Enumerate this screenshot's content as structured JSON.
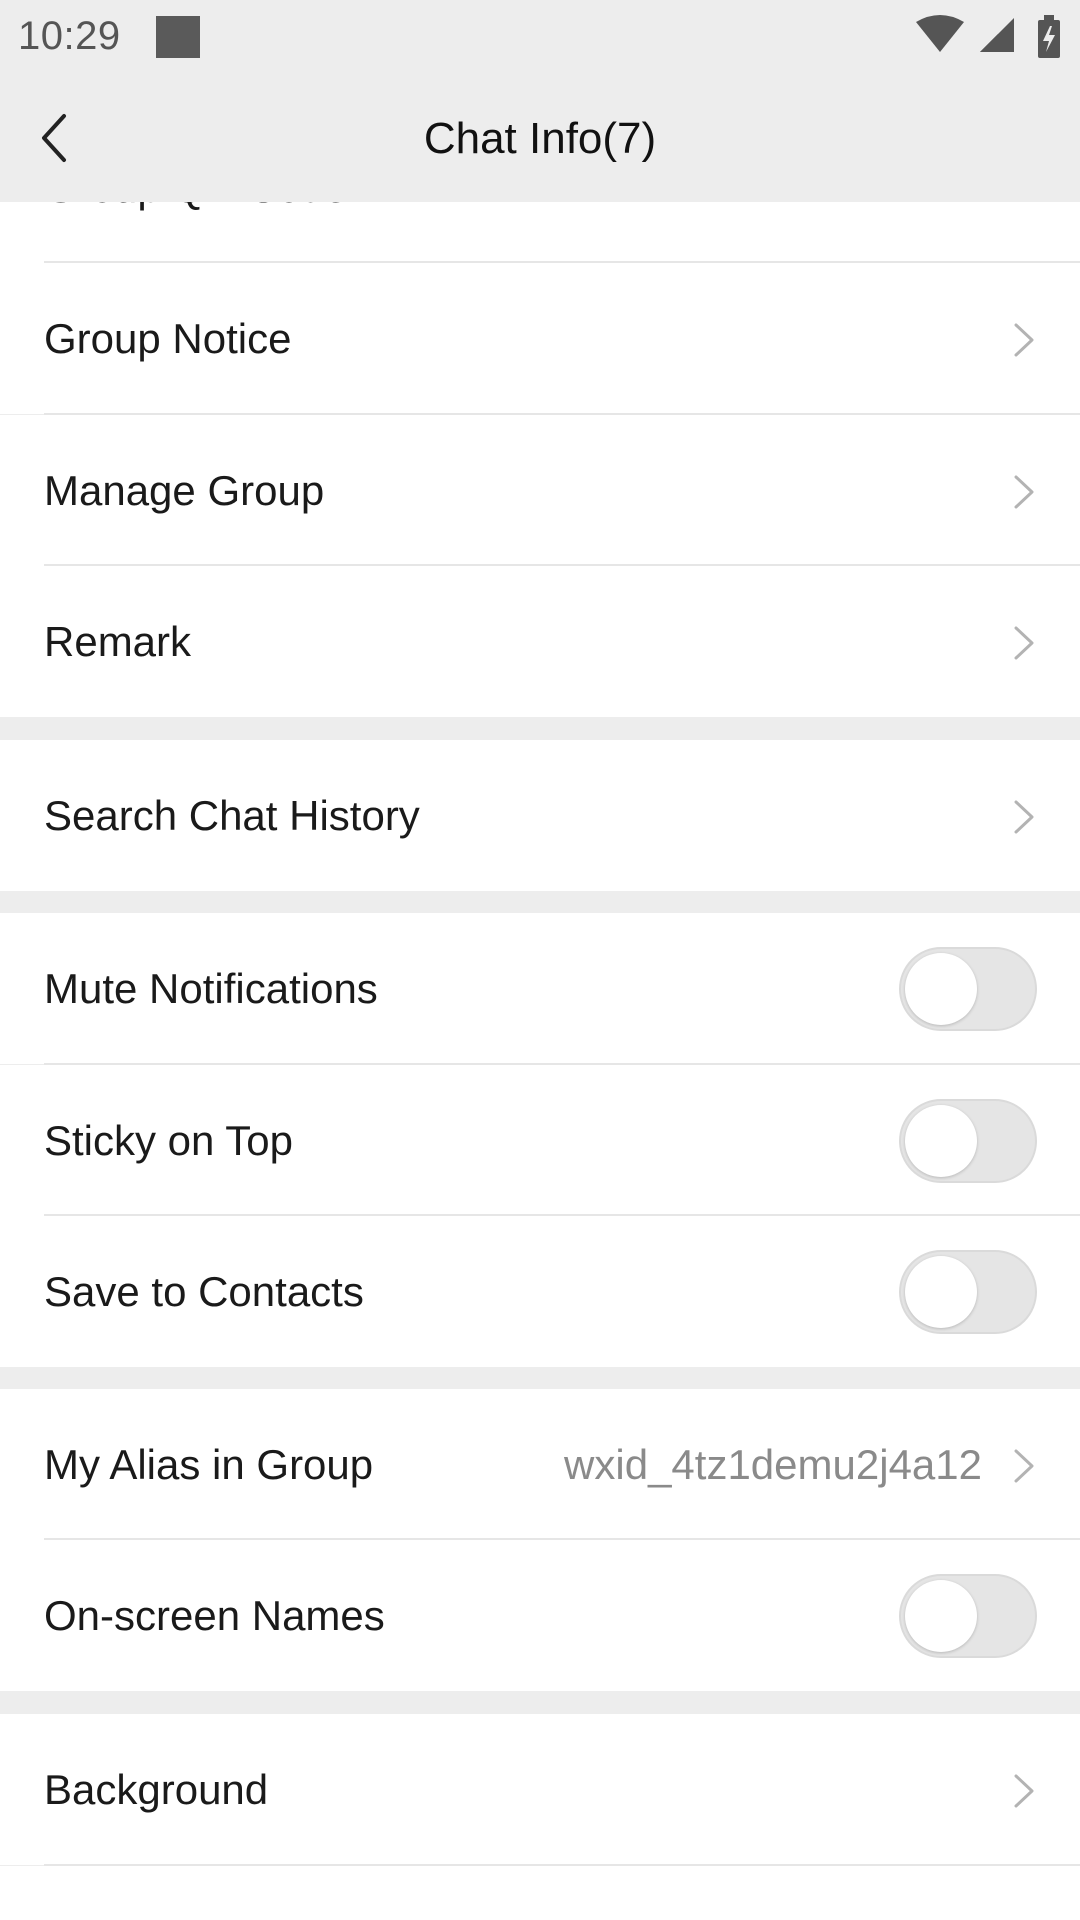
{
  "status_bar": {
    "time": "10:29"
  },
  "header": {
    "title": "Chat Info(7)"
  },
  "rows": {
    "group_qr_code": {
      "label": "Group QR Code"
    },
    "group_notice": {
      "label": "Group Notice"
    },
    "manage_group": {
      "label": "Manage Group"
    },
    "remark": {
      "label": "Remark"
    },
    "search_chat_history": {
      "label": "Search Chat History"
    },
    "mute_notifications": {
      "label": "Mute Notifications",
      "on": false
    },
    "sticky_on_top": {
      "label": "Sticky on Top",
      "on": false
    },
    "save_to_contacts": {
      "label": "Save to Contacts",
      "on": false
    },
    "my_alias_in_group": {
      "label": "My Alias in Group",
      "value": "wxid_4tz1demu2j4a12"
    },
    "on_screen_names": {
      "label": "On-screen Names",
      "on": false
    },
    "background": {
      "label": "Background"
    }
  },
  "colors": {
    "page_bg": "#ededed",
    "row_bg": "#ffffff",
    "toggle_off": "#e5e5e5"
  }
}
